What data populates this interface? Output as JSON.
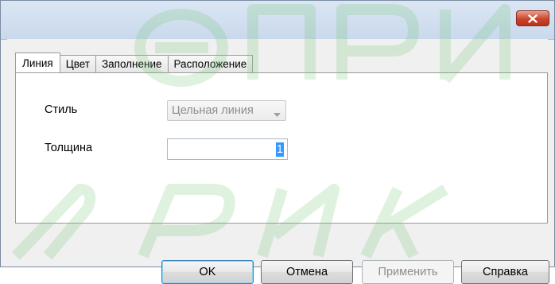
{
  "window": {
    "close_icon": "close-icon"
  },
  "tabs": [
    {
      "label": "Линия",
      "active": true
    },
    {
      "label": "Цвет",
      "active": false
    },
    {
      "label": "Заполнение",
      "active": false
    },
    {
      "label": "Расположение",
      "active": false
    }
  ],
  "form": {
    "style_label": "Стиль",
    "style_value": "Цельная линия",
    "thickness_label": "Толщина",
    "thickness_value": "1"
  },
  "buttons": {
    "ok": "OK",
    "cancel": "Отмена",
    "apply": "Применить",
    "help": "Справка"
  },
  "watermark": {
    "text_top": "ЭЛПРИБ",
    "text_bottom": "ЗОРИКА"
  },
  "colors": {
    "close_red": "#c9452d",
    "selection": "#3399ff",
    "watermark_green": "#6fc46f"
  }
}
